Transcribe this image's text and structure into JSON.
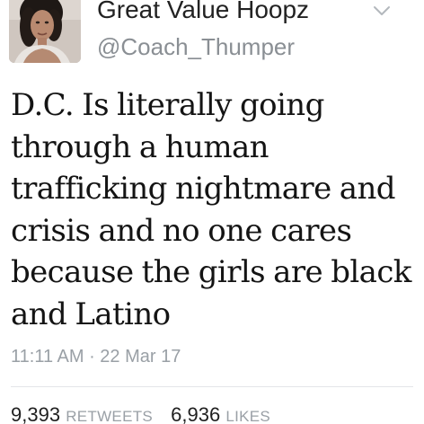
{
  "header": {
    "display_name": "Great Value Hoopz",
    "handle": "@Coach_Thumper",
    "avatar_icon": "profile-photo",
    "menu_icon": "chevron-down-icon"
  },
  "tweet": {
    "lines": [
      "D.C. Is literally going",
      "through a human",
      "trafficking nightmare and",
      "crisis and no one cares",
      "because the girls are black",
      "and Latino"
    ],
    "timestamp": "11:11 AM · 22 Mar 17"
  },
  "stats": {
    "retweets_count": "9,393",
    "retweets_label": "RETWEETS",
    "likes_count": "6,936",
    "likes_label": "LIKES"
  },
  "colors": {
    "name": "#222222",
    "secondary": "#8a8f94",
    "body": "#141414",
    "divider": "#e3e5e8"
  }
}
